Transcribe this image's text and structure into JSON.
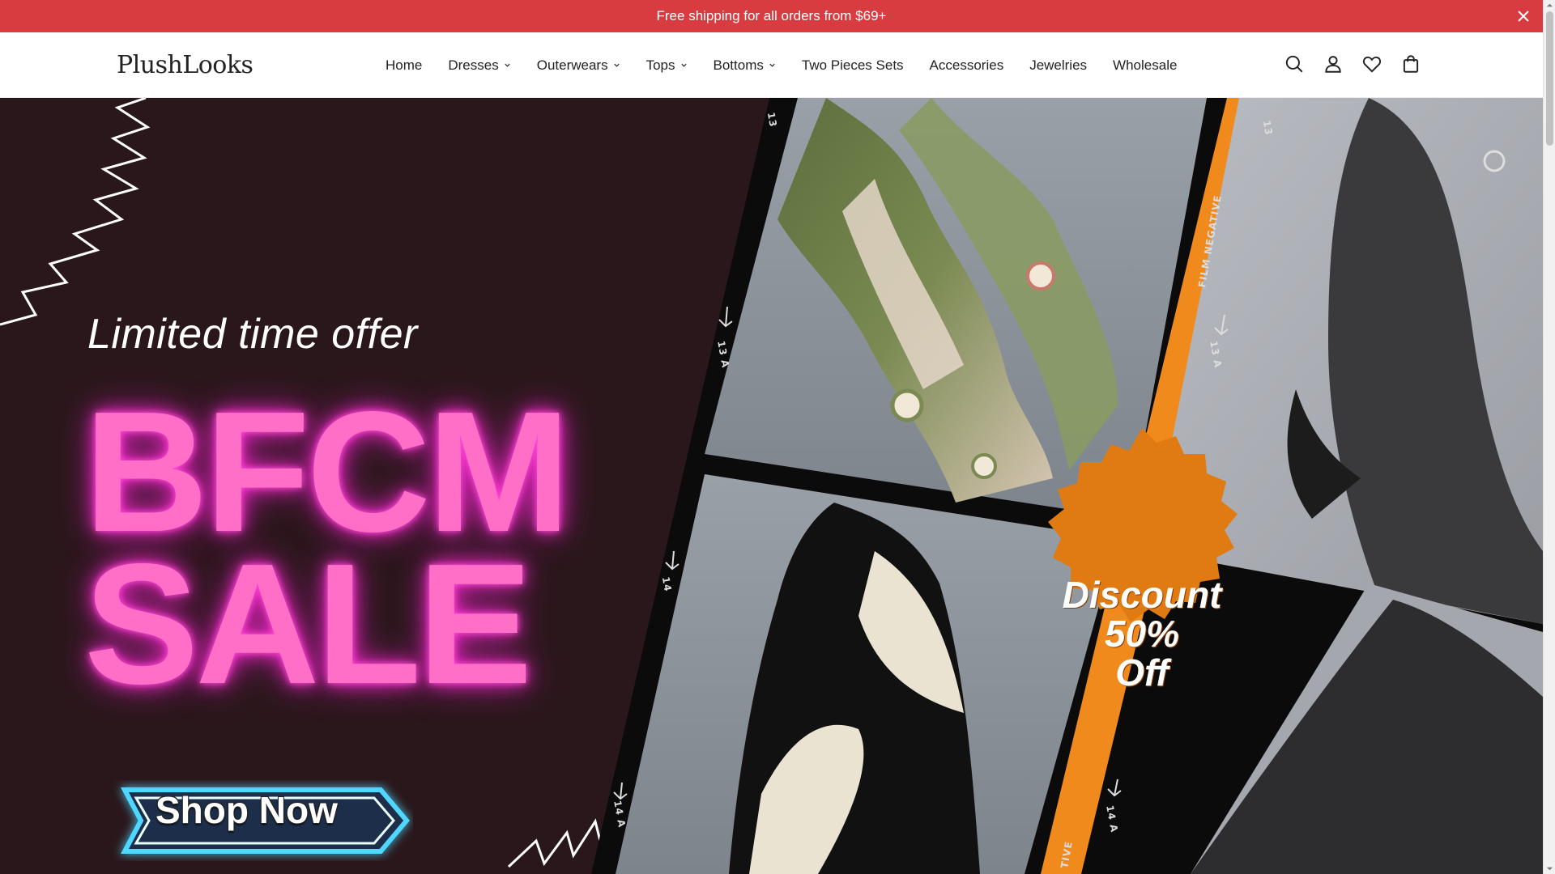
{
  "announcement": {
    "text": "Free shipping for all orders from $69+",
    "close_icon": "close-icon"
  },
  "header": {
    "logo": "PlushLooks",
    "nav": [
      {
        "label": "Home",
        "has_dropdown": false
      },
      {
        "label": "Dresses",
        "has_dropdown": true
      },
      {
        "label": "Outerwears",
        "has_dropdown": true
      },
      {
        "label": "Tops",
        "has_dropdown": true
      },
      {
        "label": "Bottoms",
        "has_dropdown": true
      },
      {
        "label": "Two Pieces Sets",
        "has_dropdown": false
      },
      {
        "label": "Accessories",
        "has_dropdown": false
      },
      {
        "label": "Jewelries",
        "has_dropdown": false
      },
      {
        "label": "Wholesale",
        "has_dropdown": false
      }
    ],
    "icons": [
      "search-icon",
      "account-icon",
      "wishlist-icon",
      "cart-icon"
    ]
  },
  "hero": {
    "tagline": "Limited time offer",
    "headline_line1": "BFCM",
    "headline_line2": "SALE",
    "cta_label": "Shop Now",
    "discount_line1": "Discount",
    "discount_line2": "50%",
    "discount_line3": "Off",
    "film_labels": [
      "13",
      "13 A",
      "14",
      "14 A",
      "FILM NEGATIVE",
      "13",
      "13 A",
      "14 A",
      "TIVE"
    ]
  },
  "colors": {
    "announcement_bg": "#d83c41",
    "hero_bg": "#2a171b",
    "neon_pink": "#ff6ec7",
    "badge_orange": "#e07a12",
    "film_orange": "#f08a1c",
    "cta_glow": "#4fd7ff"
  }
}
